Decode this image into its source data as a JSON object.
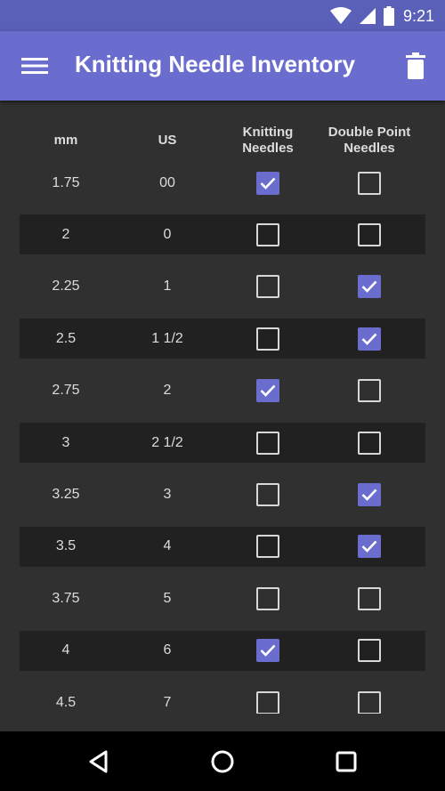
{
  "status_bar": {
    "time": "9:21"
  },
  "app_bar": {
    "title": "Knitting Needle Inventory"
  },
  "table": {
    "headers": {
      "mm": "mm",
      "us": "US",
      "knitting": "Knitting\nNeedles",
      "double_point": "Double Point\nNeedles"
    },
    "rows": [
      {
        "mm": "1.75",
        "us": "00",
        "knitting": true,
        "double_point": false
      },
      {
        "mm": "2",
        "us": "0",
        "knitting": false,
        "double_point": false
      },
      {
        "mm": "2.25",
        "us": "1",
        "knitting": false,
        "double_point": true
      },
      {
        "mm": "2.5",
        "us": "1 1/2",
        "knitting": false,
        "double_point": true
      },
      {
        "mm": "2.75",
        "us": "2",
        "knitting": true,
        "double_point": false
      },
      {
        "mm": "3",
        "us": "2 1/2",
        "knitting": false,
        "double_point": false
      },
      {
        "mm": "3.25",
        "us": "3",
        "knitting": false,
        "double_point": true
      },
      {
        "mm": "3.5",
        "us": "4",
        "knitting": false,
        "double_point": true
      },
      {
        "mm": "3.75",
        "us": "5",
        "knitting": false,
        "double_point": false
      },
      {
        "mm": "4",
        "us": "6",
        "knitting": true,
        "double_point": false
      },
      {
        "mm": "4.5",
        "us": "7",
        "knitting": false,
        "double_point": false
      }
    ]
  },
  "colors": {
    "accent": "#6b6dce",
    "status_bar": "#5a5fb8",
    "background": "#303030",
    "row_shade": "#212121"
  },
  "icons": {
    "menu": "menu-icon",
    "delete": "trash-icon",
    "back": "back-icon",
    "home": "home-icon",
    "recents": "recents-icon"
  }
}
